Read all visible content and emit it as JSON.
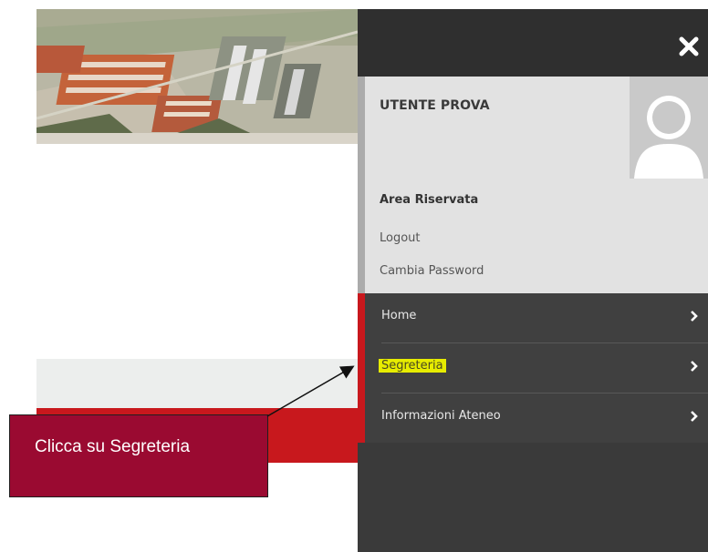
{
  "user_panel": {
    "name": "UTENTE PROVA",
    "area_title": "Area Riservata",
    "links": [
      "Logout",
      "Cambia Password"
    ]
  },
  "nav": {
    "items": [
      {
        "label": "Home",
        "icon": "chevron-right-icon"
      },
      {
        "label": "Segreteria",
        "icon": "chevron-right-icon",
        "highlighted": true,
        "highlight_color": "#e7ec00"
      },
      {
        "label": "Informazioni Ateneo",
        "icon": "chevron-right-icon"
      }
    ]
  },
  "header": {
    "close_icon": "close-icon"
  },
  "callout": {
    "text": "Clicca su Segreteria",
    "color": "#9a0a31"
  },
  "colors": {
    "menu_bg": "#404040",
    "menu_top": "#2f2f2f",
    "user_card_bg": "#e2e2e2",
    "accent_red": "#c8181d"
  },
  "background": {
    "image": "campus-aerial-photo"
  }
}
